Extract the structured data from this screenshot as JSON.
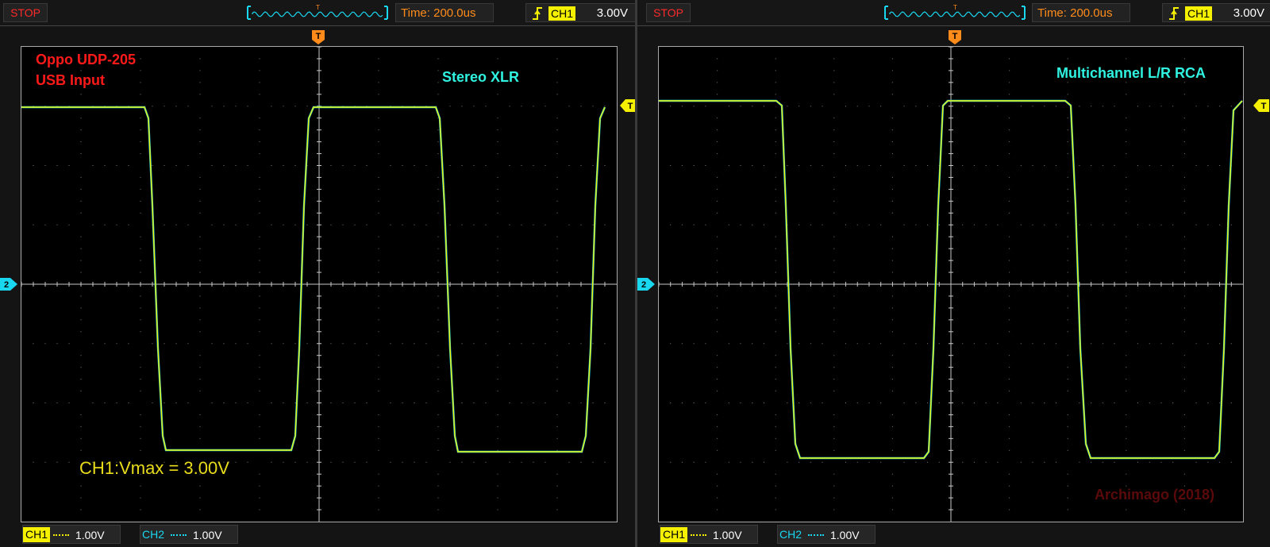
{
  "left": {
    "status": "STOP",
    "time": "Time: 200.0us",
    "trigger_channel": "CH1",
    "trigger_level": "3.00V",
    "trigger_marker": "T",
    "ch2_marker": "2",
    "title_line1": "Oppo UDP-205",
    "title_line2": "USB Input",
    "output_label": "Stereo XLR",
    "measurement": "CH1:Vmax = 3.00V",
    "ch1_label": "CH1",
    "ch1_scale": "1.00V",
    "ch2_label": "CH2",
    "ch2_scale": "1.00V"
  },
  "right": {
    "status": "STOP",
    "time": "Time: 200.0us",
    "trigger_channel": "CH1",
    "trigger_level": "3.00V",
    "trigger_marker": "T",
    "ch2_marker": "2",
    "output_label": "Multichannel L/R RCA",
    "watermark": "Archimago (2018)",
    "ch1_label": "CH1",
    "ch1_scale": "1.00V",
    "ch2_label": "CH2",
    "ch2_scale": "1.00V"
  },
  "colors": {
    "ch1": "#f4f000",
    "ch2": "#1ad7f0",
    "trigger": "#ff8c1a",
    "stop": "#ff2a2a"
  }
}
